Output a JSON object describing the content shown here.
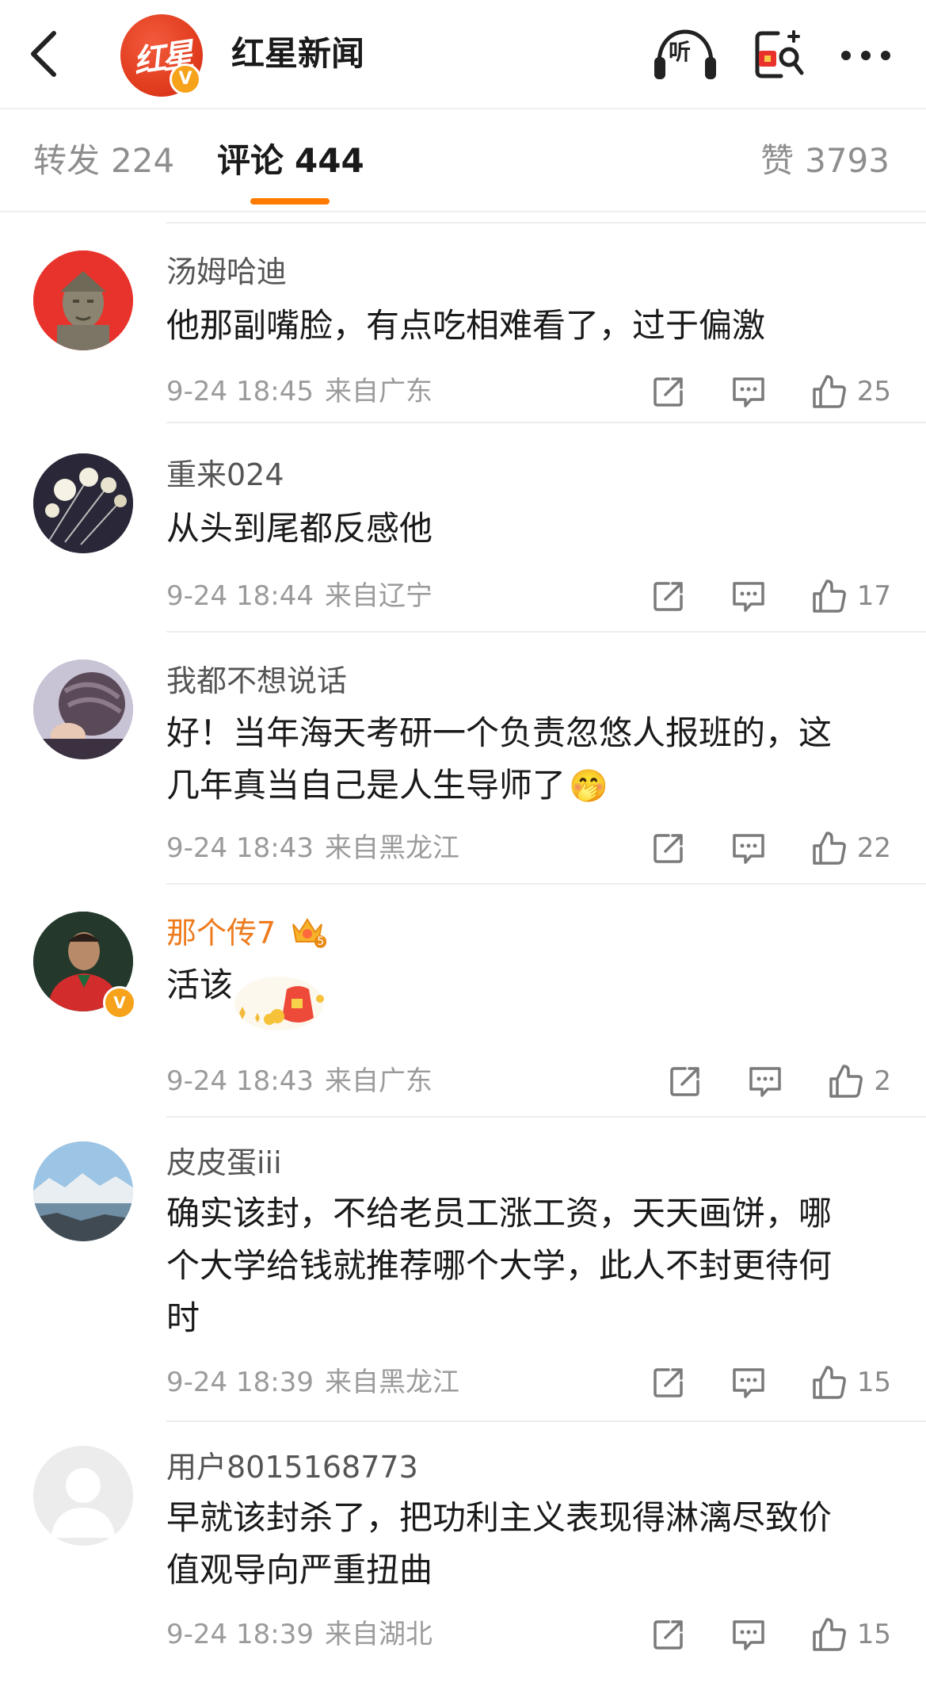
{
  "header": {
    "title": "红星新闻",
    "brand_logo_text": "红星",
    "brand_badge": "V",
    "listen_label": "听",
    "icons": [
      "back-arrow-icon",
      "headphones-icon",
      "red-packet-icon",
      "more-icon"
    ]
  },
  "tabs": {
    "forward": {
      "label": "转发",
      "count": "224"
    },
    "comments": {
      "label": "评论",
      "count": "444"
    },
    "likes": {
      "label": "赞",
      "count": "3793"
    },
    "active_color": "#ff7a00"
  },
  "comments": [
    {
      "username": "汤姆哈迪",
      "text": "他那副嘴脸，有点吃相难看了，过于偏激",
      "time": "9-24 18:45",
      "location": "来自广东",
      "likes": "25"
    },
    {
      "username": "重来024",
      "text": "从头到尾都反感他",
      "time": "9-24 18:44",
      "location": "来自辽宁",
      "likes": "17"
    },
    {
      "username": "我都不想说话",
      "text_line1": "好！当年海天考研一个负责忽悠人报班的，这",
      "text_line2": "几年真当自己是人生导师了",
      "emoji": "🤭",
      "time": "9-24 18:43",
      "location": "来自黑龙江",
      "likes": "22"
    },
    {
      "username": "那个传7",
      "vip_level": "5",
      "verified_badge": "V",
      "text": "活该",
      "time": "9-24 18:43",
      "location": "来自广东",
      "likes": "2"
    },
    {
      "username": "皮皮蛋iii",
      "text_line1": "确实该封，不给老员工涨工资，天天画饼，哪",
      "text_line2": "个大学给钱就推荐哪个大学，此人不封更待何",
      "text_line3": "时",
      "time": "9-24 18:39",
      "location": "来自黑龙江",
      "likes": "15"
    },
    {
      "username": "用户8015168773",
      "text_line1": "早就该封杀了，把功利主义表现得淋漓尽致价",
      "text_line2": "值观导向严重扭曲",
      "time": "9-24 18:39",
      "location": "来自湖北",
      "likes": "15"
    }
  ],
  "colors": {
    "accent": "#ff7a00",
    "vip_name": "#ee7b1d",
    "meta_gray": "#9b9b9b",
    "brand_red": "#e23d1f"
  }
}
